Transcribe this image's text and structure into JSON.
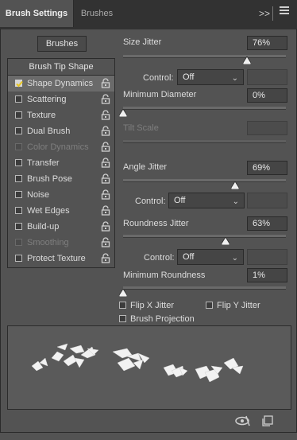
{
  "tabs": {
    "active": "Brush Settings",
    "inactive": "Brushes"
  },
  "icons": {
    "collapse": "double-chevron-right-icon",
    "menu": "hamburger-menu-icon",
    "lock": "lock-icon",
    "visibility": "eye-slash-icon",
    "new_preset": "new-preset-icon"
  },
  "brushes_button": "Brushes",
  "list": {
    "header": "Brush Tip Shape",
    "items": [
      {
        "label": "Shape Dynamics",
        "checked": true,
        "selected": true,
        "disabled": false,
        "lock": true
      },
      {
        "label": "Scattering",
        "checked": false,
        "disabled": false,
        "lock": true
      },
      {
        "label": "Texture",
        "checked": false,
        "disabled": false,
        "lock": true
      },
      {
        "label": "Dual Brush",
        "checked": false,
        "disabled": false,
        "lock": true
      },
      {
        "label": "Color Dynamics",
        "checked": false,
        "disabled": true,
        "lock": true
      },
      {
        "label": "Transfer",
        "checked": false,
        "disabled": false,
        "lock": true
      },
      {
        "label": "Brush Pose",
        "checked": false,
        "disabled": false,
        "lock": true
      },
      {
        "label": "Noise",
        "checked": false,
        "disabled": false,
        "lock": true
      },
      {
        "label": "Wet Edges",
        "checked": false,
        "disabled": false,
        "lock": true
      },
      {
        "label": "Build-up",
        "checked": false,
        "disabled": false,
        "lock": true
      },
      {
        "label": "Smoothing",
        "checked": false,
        "disabled": true,
        "lock": true
      },
      {
        "label": "Protect Texture",
        "checked": false,
        "disabled": false,
        "lock": true
      }
    ]
  },
  "settings": {
    "size_jitter": {
      "label": "Size Jitter",
      "value": "76%",
      "level": 0.76
    },
    "control1": {
      "label": "Control:",
      "value": "Off"
    },
    "min_diameter": {
      "label": "Minimum Diameter",
      "value": "0%",
      "level": 0.0
    },
    "tilt_scale": {
      "label": "Tilt Scale",
      "value": ""
    },
    "angle_jitter": {
      "label": "Angle Jitter",
      "value": "69%",
      "level": 0.69
    },
    "control2": {
      "label": "Control:",
      "value": "Off"
    },
    "roundness_jitter": {
      "label": "Roundness Jitter",
      "value": "63%",
      "level": 0.63
    },
    "control3": {
      "label": "Control:",
      "value": "Off"
    },
    "min_roundness": {
      "label": "Minimum Roundness",
      "value": "1%",
      "level": 0.0
    },
    "flip_x": {
      "label": "Flip X Jitter",
      "checked": false
    },
    "flip_y": {
      "label": "Flip Y Jitter",
      "checked": false
    },
    "brush_projection": {
      "label": "Brush Projection",
      "checked": false
    }
  },
  "colors": {
    "panel": "#535353",
    "tabbar": "#323232",
    "border": "#2b2b2b",
    "checkmark_yellow": "#e8c51e"
  }
}
